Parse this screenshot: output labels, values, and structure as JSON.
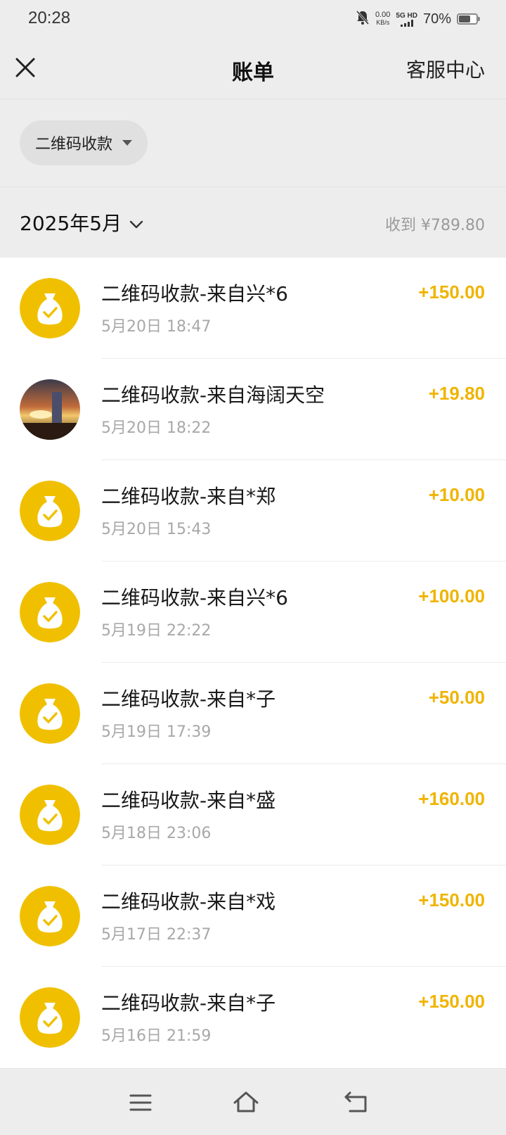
{
  "status_bar": {
    "time": "20:28",
    "net_speed_value": "0.00",
    "net_speed_unit": "KB/s",
    "network_label": "5G HD",
    "battery_text": "70%",
    "battery_level": 0.7,
    "icons": [
      "bell-muted-icon",
      "signal-icon",
      "battery-icon"
    ]
  },
  "nav": {
    "title": "账单",
    "service_label": "客服中心",
    "close_icon": "close-icon"
  },
  "filter": {
    "label": "二维码收款"
  },
  "month": {
    "label": "2025年5月",
    "summary": "收到 ¥789.80"
  },
  "colors": {
    "accent": "#f0b400",
    "background": "#ededed"
  },
  "transactions": [
    {
      "title": "二维码收款-来自兴*6",
      "time": "5月20日 18:47",
      "amount": "+150.00",
      "avatar": "money-bag-icon"
    },
    {
      "title": "二维码收款-来自海阔天空",
      "time": "5月20日 18:22",
      "amount": "+19.80",
      "avatar": "sunset-photo"
    },
    {
      "title": "二维码收款-来自*郑",
      "time": "5月20日 15:43",
      "amount": "+10.00",
      "avatar": "money-bag-icon"
    },
    {
      "title": "二维码收款-来自兴*6",
      "time": "5月19日 22:22",
      "amount": "+100.00",
      "avatar": "money-bag-icon"
    },
    {
      "title": "二维码收款-来自*子",
      "time": "5月19日 17:39",
      "amount": "+50.00",
      "avatar": "money-bag-icon"
    },
    {
      "title": "二维码收款-来自*盛",
      "time": "5月18日 23:06",
      "amount": "+160.00",
      "avatar": "money-bag-icon"
    },
    {
      "title": "二维码收款-来自*戏",
      "time": "5月17日 22:37",
      "amount": "+150.00",
      "avatar": "money-bag-icon"
    },
    {
      "title": "二维码收款-来自*子",
      "time": "5月16日 21:59",
      "amount": "+150.00",
      "avatar": "money-bag-icon"
    }
  ],
  "system_nav": {
    "icons": [
      "menu-icon",
      "home-icon",
      "back-icon"
    ]
  }
}
